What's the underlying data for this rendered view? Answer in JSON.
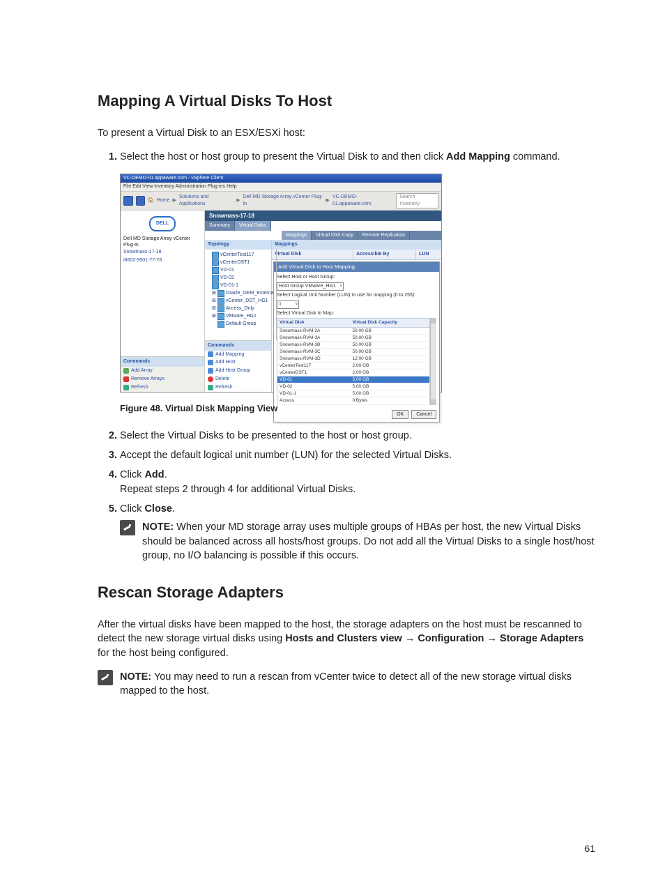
{
  "page_number": "61",
  "section1": {
    "heading": "Mapping A Virtual Disks To Host",
    "intro": "To present a Virtual Disk to an ESX/ESXi host:",
    "step1_a": "Select the host or host group to present the Virtual Disk to and then click ",
    "step1_b": "Add Mapping",
    "step1_c": " command.",
    "figure_caption": "Figure 48. Virtual Disk Mapping View",
    "step2": "Select the Virtual Disks to be presented to the host or host group.",
    "step3": "Accept the default logical unit number (LUN) for the selected Virtual Disks.",
    "step4_a": "Click ",
    "step4_b": "Add",
    "step4_c": ".",
    "step4_repeat": "Repeat steps 2 through 4 for additional Virtual Disks.",
    "step5_a": "Click ",
    "step5_b": "Close",
    "step5_c": ".",
    "note_label": "NOTE:",
    "note_text": " When your MD storage array uses multiple groups of HBAs per host, the new Virtual Disks should be balanced across all hosts/host groups. Do not add all the Virtual Disks to a single host/host group, no I/O balancing is possible if this occurs."
  },
  "section2": {
    "heading": "Rescan Storage Adapters",
    "para_a": "After the virtual disks have been mapped to the host, the storage adapters on the host must be rescanned to detect the new storage virtual disks using ",
    "para_b": "Hosts and Clusters view",
    "para_c": " → ",
    "para_d": "Configuration",
    "para_e": " → ",
    "para_f": "Storage Adapters",
    "para_g": " for the host being configured.",
    "note_label": "NOTE:",
    "note_text": " You may need to run a rescan from vCenter twice to detect all of the new storage virtual disks mapped to the host."
  },
  "fig": {
    "window_title": "VC-DEMO-01.appaware.com - vSphere Client",
    "menubar": "File  Edit  View  Inventory  Administration  Plug-ins  Help",
    "crumb_home": "Home",
    "crumb_sol": "Solutions and Applications",
    "crumb_plug": "Dell MD Storage Array vCenter Plug-in",
    "crumb_host": "VC-DEMO-01.appaware.com",
    "search_placeholder": "Search Inventory",
    "dell_logo": "DELL",
    "left_heading": "Dell MD Storage Array vCenter Plug-in",
    "left_items": [
      "Snowmass-17-18",
      "i8602-9501-77-78"
    ],
    "left_cmds_header": "Commands",
    "left_cmds": [
      "Add Array",
      "Remove Arrays",
      "Refresh"
    ],
    "array_title": "Snowmass-17-18",
    "tabs1": [
      "Summary",
      "Virtual Disks"
    ],
    "tabs2": [
      "Mappings",
      "Virtual Disk Copy",
      "Remote Replication"
    ],
    "topology_header": "Topology",
    "tree": [
      "vCenterTest117",
      "vCenterDST1",
      "VD-01",
      "VD-02",
      "VD-01-1",
      "Oracle_OEM_External",
      "vCenter_DST_HG1",
      "Access_Only",
      "VMware_HG1",
      "Default Group"
    ],
    "topo_cmds_header": "Commands",
    "topo_cmds": [
      "Add Mapping",
      "Add Host",
      "Add Host Group",
      "Delete",
      "Refresh"
    ],
    "map_header": "Mappings",
    "map_cols": [
      "Virtual Disk",
      "Accessible By",
      "LUN"
    ],
    "modal_title": "Add Virtual Disk to Host Mapping",
    "modal_l1": "Select Host or Host Group:",
    "modal_hg": "Host Group VMware_HG1",
    "modal_l2": "Select Logical Unit Number (LUN) to use for mapping (0 to 255):",
    "modal_lun": "1",
    "modal_l3": "Select Virtual Disk to Map:",
    "vd_cols": [
      "Virtual Disk",
      "Virtual Disk Capacity"
    ],
    "vd_rows": [
      {
        "n": "Snowmass-RVM-2A",
        "c": "50.00 GB"
      },
      {
        "n": "Snowmass-RVM-3A",
        "c": "50.00 GB"
      },
      {
        "n": "Snowmass-RVM-3B",
        "c": "50.00 GB"
      },
      {
        "n": "Snowmass-RVM-3C",
        "c": "50.00 GB"
      },
      {
        "n": "Snowmass-RVM-3D",
        "c": "12.00 GB"
      },
      {
        "n": "vCenterTest117",
        "c": "2.00 GB"
      },
      {
        "n": "vCenterDST1",
        "c": "2.00 GB"
      },
      {
        "n": "VD-01",
        "c": "5.00 GB",
        "sel": true
      },
      {
        "n": "VD-02",
        "c": "5.00 GB"
      },
      {
        "n": "VD-01-1",
        "c": "5.00 GB"
      },
      {
        "n": "Access",
        "c": "0 Bytes"
      }
    ],
    "btn_ok": "OK",
    "btn_cancel": "Cancel"
  }
}
